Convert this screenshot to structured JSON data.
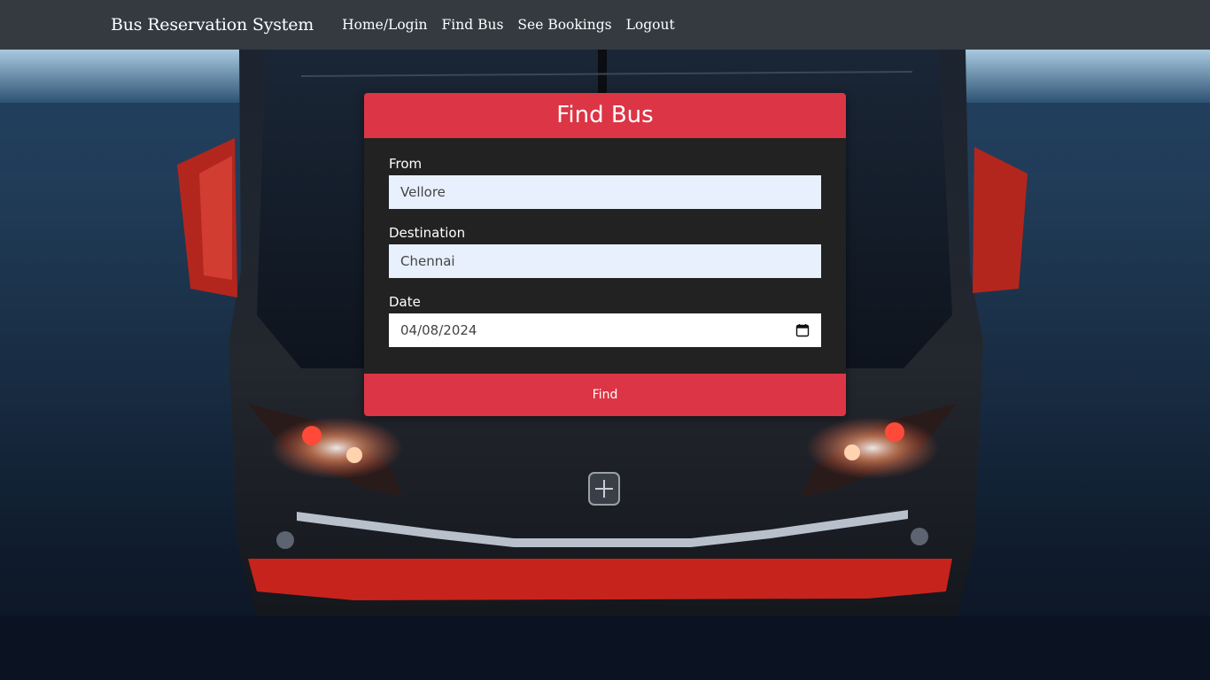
{
  "navbar": {
    "brand": "Bus Reservation System",
    "links": [
      "Home/Login",
      "Find Bus",
      "See Bookings",
      "Logout"
    ]
  },
  "card": {
    "title": "Find Bus",
    "fields": {
      "from": {
        "label": "From",
        "value": "Vellore"
      },
      "destination": {
        "label": "Destination",
        "value": "Chennai"
      },
      "date": {
        "label": "Date",
        "value": "04/08/2024"
      }
    },
    "submit_label": "Find"
  },
  "background": {
    "description_icon": "bus-front-photo",
    "accent_color": "#dc3545",
    "navbar_color": "#343a40"
  }
}
